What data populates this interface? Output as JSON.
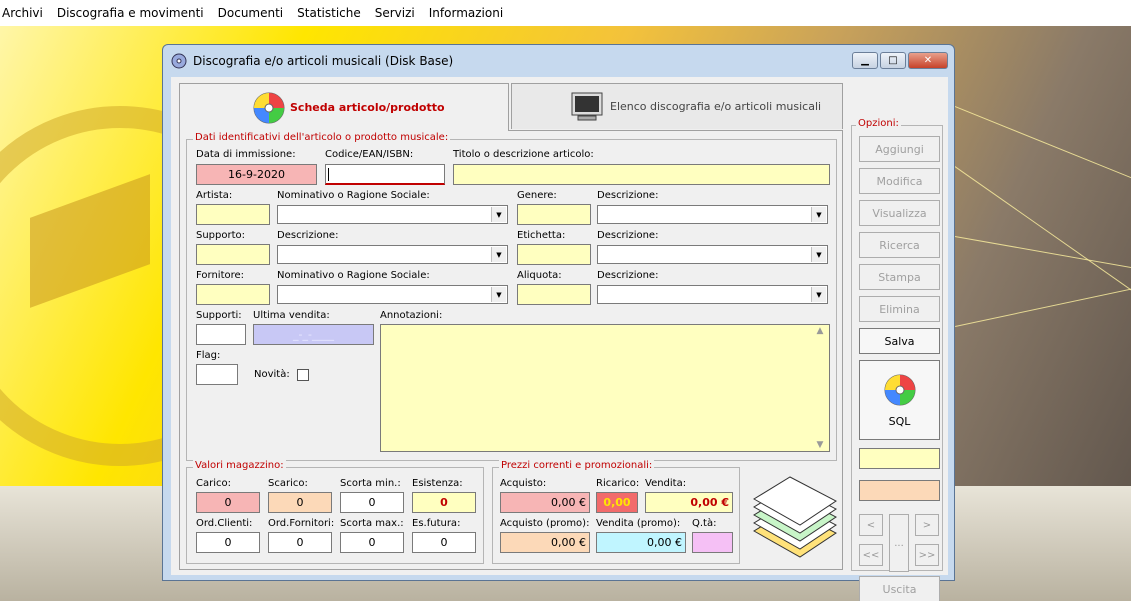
{
  "menu": [
    "Archivi",
    "Discografia e movimenti",
    "Documenti",
    "Statistiche",
    "Servizi",
    "Informazioni"
  ],
  "window": {
    "title": "Discografia e/o articoli musicali (Disk Base)"
  },
  "tabs": {
    "scheda": "Scheda articolo/prodotto",
    "elenco": "Elenco discografia e/o articoli musicali"
  },
  "ident": {
    "legend": "Dati identificativi dell'articolo o prodotto musicale:",
    "data_label": "Data di immissione:",
    "data_value": "16-9-2020",
    "codice_label": "Codice/EAN/ISBN:",
    "codice_value": "",
    "titolo_label": "Titolo o descrizione articolo:",
    "titolo_value": "",
    "artista_label": "Artista:",
    "artista_nom_label": "Nominativo o Ragione Sociale:",
    "genere_label": "Genere:",
    "genere_desc_label": "Descrizione:",
    "supporto_label": "Supporto:",
    "supporto_desc_label": "Descrizione:",
    "etichetta_label": "Etichetta:",
    "etichetta_desc_label": "Descrizione:",
    "fornitore_label": "Fornitore:",
    "fornitore_nom_label": "Nominativo o Ragione Sociale:",
    "aliquota_label": "Aliquota:",
    "aliquota_desc_label": "Descrizione:",
    "supporti_label": "Supporti:",
    "ultima_label": "Ultima vendita:",
    "ultima_value": "_-_-____",
    "annotazioni_label": "Annotazioni:",
    "flag_label": "Flag:",
    "novita_label": "Novità:"
  },
  "magazzino": {
    "legend": "Valori magazzino:",
    "carico_label": "Carico:",
    "carico": "0",
    "scarico_label": "Scarico:",
    "scarico": "0",
    "scortamin_label": "Scorta min.:",
    "scortamin": "0",
    "esistenza_label": "Esistenza:",
    "esistenza": "0",
    "ordcli_label": "Ord.Clienti:",
    "ordcli": "0",
    "ordforn_label": "Ord.Fornitori:",
    "ordforn": "0",
    "scortamax_label": "Scorta max.:",
    "scortamax": "0",
    "esfutura_label": "Es.futura:",
    "esfutura": "0"
  },
  "prezzi": {
    "legend": "Prezzi correnti e promozionali:",
    "acquisto_label": "Acquisto:",
    "acquisto": "0,00 €",
    "ricarico_label": "Ricarico:",
    "ricarico": "0,00",
    "vendita_label": "Vendita:",
    "vendita": "0,00 €",
    "acqpromo_label": "Acquisto (promo):",
    "acqpromo": "0,00 €",
    "vendpromo_label": "Vendita (promo):",
    "vendpromo": "0,00 €",
    "qta_label": "Q.tà:"
  },
  "opzioni": {
    "legend": "Opzioni:",
    "aggiungi": "Aggiungi",
    "modifica": "Modifica",
    "visualizza": "Visualizza",
    "ricerca": "Ricerca",
    "stampa": "Stampa",
    "elimina": "Elimina",
    "salva": "Salva",
    "sql": "SQL",
    "uscita": "Uscita",
    "nav_prev": "<",
    "nav_next": ">",
    "nav_first": "<<",
    "nav_last": ">>",
    "nav_mid": "..."
  },
  "colors": {
    "accent_red": "#c00000",
    "field_yellow": "#ffffc0",
    "field_pink": "#f7b5b5",
    "field_peach": "#fcd9b8",
    "field_lilac": "#c8c8f5",
    "field_cyan": "#c0f5ff",
    "field_magenta": "#f5c0f5"
  }
}
